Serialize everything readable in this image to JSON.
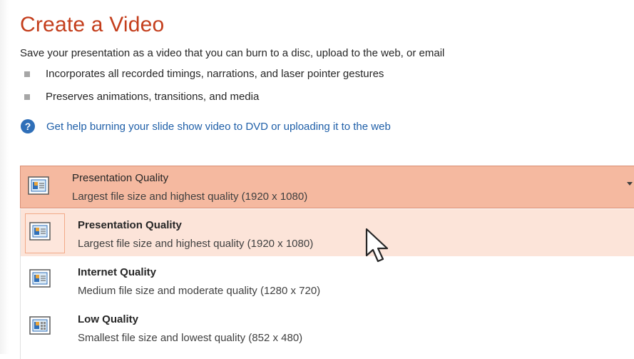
{
  "title": "Create a Video",
  "description": "Save your presentation as a video that you can burn to a disc, upload to the web, or email",
  "bullets": [
    "Incorporates all recorded timings, narrations, and laser pointer gestures",
    "Preserves animations, transitions, and media"
  ],
  "help_link": "Get help burning your slide show video to DVD or uploading it to the web",
  "help_icon": "?",
  "dropdown": {
    "selected_title": "Presentation Quality",
    "selected_desc": "Largest file size and highest quality (1920 x 1080)"
  },
  "options": [
    {
      "title": "Presentation Quality",
      "desc": "Largest file size and highest quality (1920 x 1080)"
    },
    {
      "title": "Internet Quality",
      "desc": "Medium file size and moderate quality (1280 x 720)"
    },
    {
      "title": "Low Quality",
      "desc": "Smallest file size and lowest quality (852 x 480)"
    }
  ],
  "colors": {
    "title": "#c43e1c",
    "link": "#1f5fa8",
    "dropdown_bg": "#f5b9a0",
    "selected_option_bg": "#fce4d9"
  }
}
